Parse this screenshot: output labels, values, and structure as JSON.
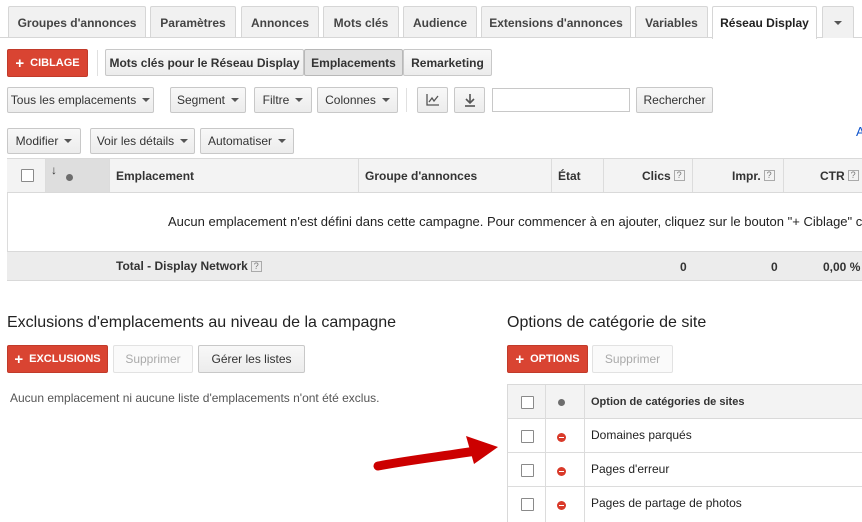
{
  "tabs": [
    {
      "label": "Groupes d'annonces"
    },
    {
      "label": "Paramètres"
    },
    {
      "label": "Annonces"
    },
    {
      "label": "Mots clés"
    },
    {
      "label": "Audience"
    },
    {
      "label": "Extensions d'annonces"
    },
    {
      "label": "Variables"
    },
    {
      "label": "Réseau Display"
    }
  ],
  "active_tab": "Réseau Display",
  "toolbar": {
    "ciblage_label": "CIBLAGE",
    "subtabs": [
      {
        "label": "Mots clés pour le Réseau Display"
      },
      {
        "label": "Emplacements"
      },
      {
        "label": "Remarketing"
      }
    ],
    "selected_subtab": "Emplacements",
    "filter_all": "Tous les emplacements",
    "segment": "Segment",
    "filtre": "Filtre",
    "colonnes": "Colonnes",
    "search_value": "",
    "search_button": "Rechercher",
    "modifier": "Modifier",
    "voir_details": "Voir les détails",
    "automatiser": "Automatiser",
    "edge_link": "A"
  },
  "table": {
    "headers": {
      "emplacement": "Emplacement",
      "groupe": "Groupe d'annonces",
      "etat": "État",
      "clics": "Clics",
      "impr": "Impr.",
      "ctr": "CTR"
    },
    "sort_arrow": "↓",
    "empty_message": "Aucun emplacement n'est défini dans cette campagne. Pour commencer à en ajouter, cliquez sur le bouton \"+ Ciblage\" c",
    "total_label": "Total - Display Network",
    "total_clics": "0",
    "total_impr": "0",
    "total_ctr": "0,00 %"
  },
  "exclusions": {
    "title": "Exclusions d'emplacements au niveau de la campagne",
    "add_label": "EXCLUSIONS",
    "delete_label": "Supprimer",
    "manage_label": "Gérer les listes",
    "empty_text": "Aucun emplacement ni aucune liste d'emplacements n'ont été exclus."
  },
  "site_categories": {
    "title": "Options de catégorie de site",
    "add_label": "OPTIONS",
    "delete_label": "Supprimer",
    "column_header": "Option de catégories de sites",
    "rows": [
      {
        "label": "Domaines parqués"
      },
      {
        "label": "Pages d'erreur"
      },
      {
        "label": "Pages de partage de photos"
      }
    ]
  },
  "colors": {
    "accent_red": "#d94432",
    "annotation_arrow": "#cc0000"
  }
}
